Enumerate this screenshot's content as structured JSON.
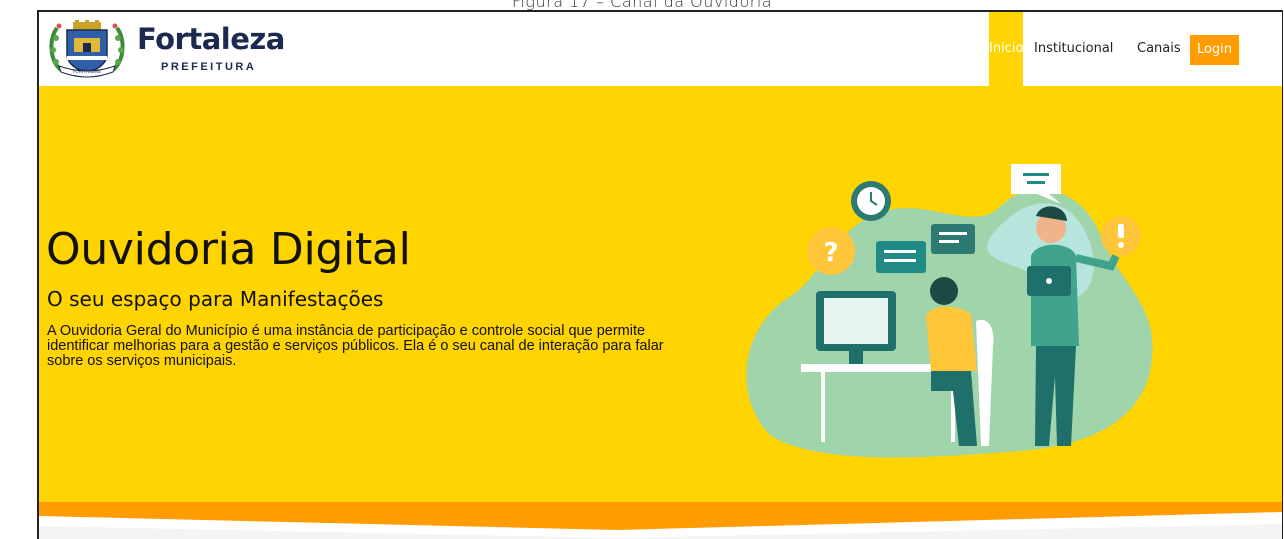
{
  "caption": "Figura 17 – Canal da Ouvidoria",
  "brand": {
    "name": "Fortaleza",
    "subtitle": "PREFEITURA",
    "crest_motto": "FORTITUDINE"
  },
  "nav": {
    "items": [
      {
        "label": "Inicio",
        "active": true
      },
      {
        "label": "Institucional",
        "active": false
      },
      {
        "label": "Canais",
        "active": false
      }
    ],
    "login_label": "Login"
  },
  "hero": {
    "title": "Ouvidoria Digital",
    "subtitle": "O seu espaço para Manifestações",
    "description": "A Ouvidoria Geral do Município é uma instância de participação e controle social que permite identificar melhorias para a gestão e serviços públicos. Ela é o seu canal de interação para falar sobre os serviços municipais."
  },
  "colors": {
    "hero_background": "#ffd400",
    "accent_orange": "#ff9c00",
    "brand_navy": "#1d2a4f",
    "illustration_teal": "#1f8a86"
  },
  "icons": [
    "coat-of-arms-icon",
    "clock-icon",
    "question-bubble-icon",
    "chat-bubble-icon",
    "exclamation-bubble-icon",
    "computer-monitor-icon",
    "laptop-icon"
  ]
}
